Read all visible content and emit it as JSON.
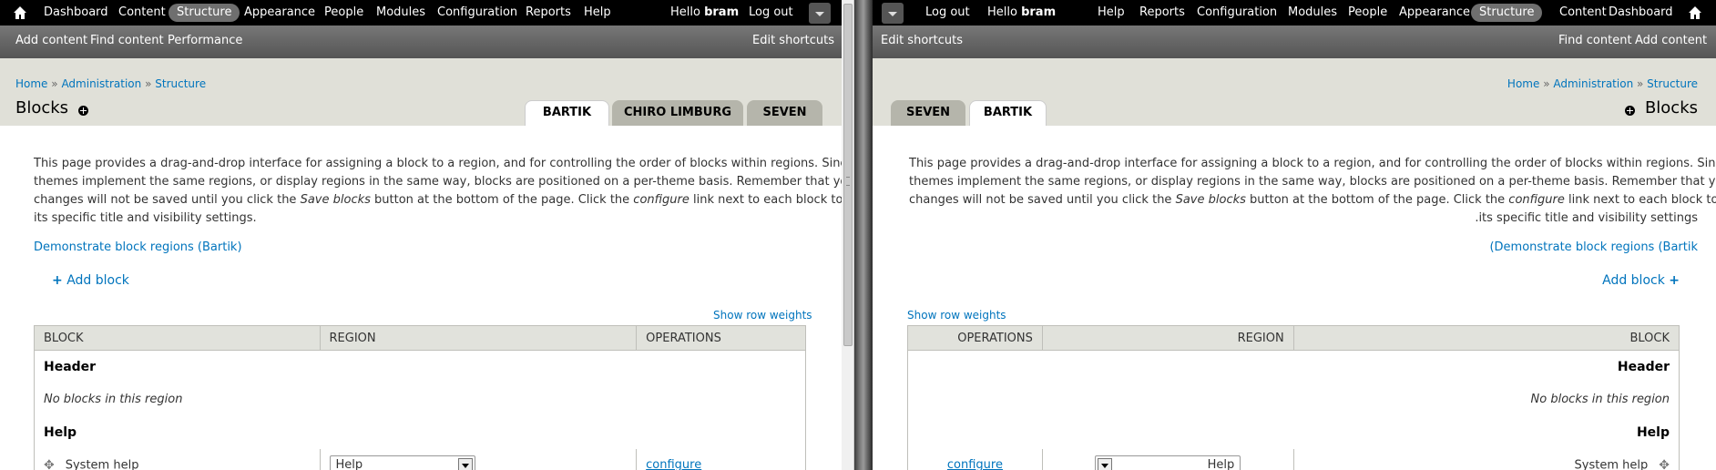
{
  "toolbar": {
    "home_icon": "home-icon",
    "items": [
      "Dashboard",
      "Content",
      "Structure",
      "Appearance",
      "People",
      "Modules",
      "Configuration",
      "Reports",
      "Help"
    ],
    "active": "Structure",
    "hello": "Hello",
    "user": "bram",
    "logout": "Log out"
  },
  "shortcuts": {
    "add_content": "Add content",
    "find_content": "Find content",
    "performance": "Performance",
    "edit_shortcuts": "Edit shortcuts"
  },
  "breadcrumb": {
    "home": "Home",
    "admin": "Administration",
    "structure": "Structure",
    "sep": "»"
  },
  "page": {
    "title": "Blocks",
    "tabs": [
      "BARTIK",
      "CHIRO LIMBURG",
      "SEVEN"
    ],
    "tabs_rtl": [
      "SEVEN",
      "BARTIK"
    ],
    "active_tab": "BARTIK",
    "description_lines_ltr": [
      "This page provides a drag-and-drop interface for assigning a block to a region, and for controlling the order of blocks within regions. Since not all",
      "themes implement the same regions, or display regions in the same way, blocks are positioned on a per-theme basis. Remember that your",
      "changes will not be saved until you click the |Save blocks| button at the bottom of the page. Click the |configure| link next to each block to configure",
      "its specific title and visibility settings."
    ],
    "description_lines_rtl": [
      "This page provides a drag-and-drop interface for assigning a block to a region, and for controlling the order of blocks within regions. Since not all",
      "themes implement the same regions, or display regions in the same way, blocks are positioned on a per-theme basis. Remember that your",
      "changes will not be saved until you click the |Save blocks| button at the bottom of the page. Click the |configure| link next to each block to configure",
      ".its specific title and visibility settings"
    ],
    "demo_link": "Demonstrate block regions (Bartik)",
    "demo_link_rtl": "(Demonstrate block regions (Bartik",
    "add_block": "Add block",
    "show_row_weights": "Show row weights"
  },
  "table": {
    "headers": [
      "BLOCK",
      "REGION",
      "OPERATIONS"
    ],
    "rows": [
      {
        "kind": "region",
        "text": "Header"
      },
      {
        "kind": "empty",
        "text": "No blocks in this region"
      },
      {
        "kind": "region",
        "text": "Help"
      },
      {
        "kind": "block",
        "block": "System help",
        "region": "Help",
        "op": "configure"
      }
    ]
  },
  "colors": {
    "toolbar_bg": "#000000",
    "shortcut_bg": "#666666",
    "header_bg": "#e0e0d8",
    "link": "#0074bd",
    "tab_inactive": "#b5b5ab",
    "active_pill": "#6f6f6f"
  }
}
